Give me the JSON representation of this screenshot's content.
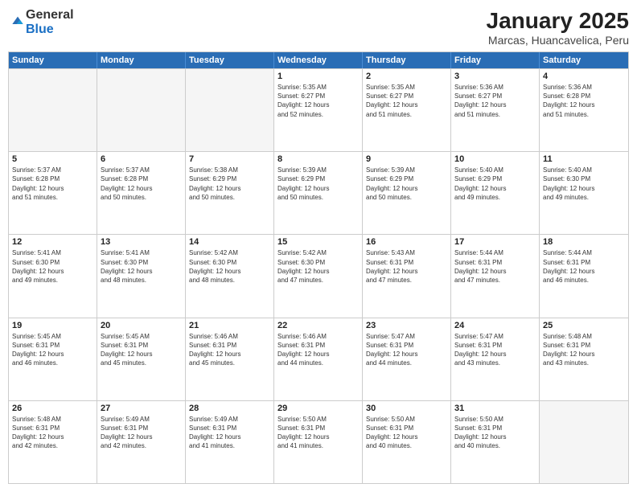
{
  "logo": {
    "general": "General",
    "blue": "Blue"
  },
  "title": "January 2025",
  "subtitle": "Marcas, Huancavelica, Peru",
  "weekdays": [
    "Sunday",
    "Monday",
    "Tuesday",
    "Wednesday",
    "Thursday",
    "Friday",
    "Saturday"
  ],
  "weeks": [
    [
      {
        "day": "",
        "info": ""
      },
      {
        "day": "",
        "info": ""
      },
      {
        "day": "",
        "info": ""
      },
      {
        "day": "1",
        "info": "Sunrise: 5:35 AM\nSunset: 6:27 PM\nDaylight: 12 hours\nand 52 minutes."
      },
      {
        "day": "2",
        "info": "Sunrise: 5:35 AM\nSunset: 6:27 PM\nDaylight: 12 hours\nand 51 minutes."
      },
      {
        "day": "3",
        "info": "Sunrise: 5:36 AM\nSunset: 6:27 PM\nDaylight: 12 hours\nand 51 minutes."
      },
      {
        "day": "4",
        "info": "Sunrise: 5:36 AM\nSunset: 6:28 PM\nDaylight: 12 hours\nand 51 minutes."
      }
    ],
    [
      {
        "day": "5",
        "info": "Sunrise: 5:37 AM\nSunset: 6:28 PM\nDaylight: 12 hours\nand 51 minutes."
      },
      {
        "day": "6",
        "info": "Sunrise: 5:37 AM\nSunset: 6:28 PM\nDaylight: 12 hours\nand 50 minutes."
      },
      {
        "day": "7",
        "info": "Sunrise: 5:38 AM\nSunset: 6:29 PM\nDaylight: 12 hours\nand 50 minutes."
      },
      {
        "day": "8",
        "info": "Sunrise: 5:39 AM\nSunset: 6:29 PM\nDaylight: 12 hours\nand 50 minutes."
      },
      {
        "day": "9",
        "info": "Sunrise: 5:39 AM\nSunset: 6:29 PM\nDaylight: 12 hours\nand 50 minutes."
      },
      {
        "day": "10",
        "info": "Sunrise: 5:40 AM\nSunset: 6:29 PM\nDaylight: 12 hours\nand 49 minutes."
      },
      {
        "day": "11",
        "info": "Sunrise: 5:40 AM\nSunset: 6:30 PM\nDaylight: 12 hours\nand 49 minutes."
      }
    ],
    [
      {
        "day": "12",
        "info": "Sunrise: 5:41 AM\nSunset: 6:30 PM\nDaylight: 12 hours\nand 49 minutes."
      },
      {
        "day": "13",
        "info": "Sunrise: 5:41 AM\nSunset: 6:30 PM\nDaylight: 12 hours\nand 48 minutes."
      },
      {
        "day": "14",
        "info": "Sunrise: 5:42 AM\nSunset: 6:30 PM\nDaylight: 12 hours\nand 48 minutes."
      },
      {
        "day": "15",
        "info": "Sunrise: 5:42 AM\nSunset: 6:30 PM\nDaylight: 12 hours\nand 47 minutes."
      },
      {
        "day": "16",
        "info": "Sunrise: 5:43 AM\nSunset: 6:31 PM\nDaylight: 12 hours\nand 47 minutes."
      },
      {
        "day": "17",
        "info": "Sunrise: 5:44 AM\nSunset: 6:31 PM\nDaylight: 12 hours\nand 47 minutes."
      },
      {
        "day": "18",
        "info": "Sunrise: 5:44 AM\nSunset: 6:31 PM\nDaylight: 12 hours\nand 46 minutes."
      }
    ],
    [
      {
        "day": "19",
        "info": "Sunrise: 5:45 AM\nSunset: 6:31 PM\nDaylight: 12 hours\nand 46 minutes."
      },
      {
        "day": "20",
        "info": "Sunrise: 5:45 AM\nSunset: 6:31 PM\nDaylight: 12 hours\nand 45 minutes."
      },
      {
        "day": "21",
        "info": "Sunrise: 5:46 AM\nSunset: 6:31 PM\nDaylight: 12 hours\nand 45 minutes."
      },
      {
        "day": "22",
        "info": "Sunrise: 5:46 AM\nSunset: 6:31 PM\nDaylight: 12 hours\nand 44 minutes."
      },
      {
        "day": "23",
        "info": "Sunrise: 5:47 AM\nSunset: 6:31 PM\nDaylight: 12 hours\nand 44 minutes."
      },
      {
        "day": "24",
        "info": "Sunrise: 5:47 AM\nSunset: 6:31 PM\nDaylight: 12 hours\nand 43 minutes."
      },
      {
        "day": "25",
        "info": "Sunrise: 5:48 AM\nSunset: 6:31 PM\nDaylight: 12 hours\nand 43 minutes."
      }
    ],
    [
      {
        "day": "26",
        "info": "Sunrise: 5:48 AM\nSunset: 6:31 PM\nDaylight: 12 hours\nand 42 minutes."
      },
      {
        "day": "27",
        "info": "Sunrise: 5:49 AM\nSunset: 6:31 PM\nDaylight: 12 hours\nand 42 minutes."
      },
      {
        "day": "28",
        "info": "Sunrise: 5:49 AM\nSunset: 6:31 PM\nDaylight: 12 hours\nand 41 minutes."
      },
      {
        "day": "29",
        "info": "Sunrise: 5:50 AM\nSunset: 6:31 PM\nDaylight: 12 hours\nand 41 minutes."
      },
      {
        "day": "30",
        "info": "Sunrise: 5:50 AM\nSunset: 6:31 PM\nDaylight: 12 hours\nand 40 minutes."
      },
      {
        "day": "31",
        "info": "Sunrise: 5:50 AM\nSunset: 6:31 PM\nDaylight: 12 hours\nand 40 minutes."
      },
      {
        "day": "",
        "info": ""
      }
    ]
  ]
}
